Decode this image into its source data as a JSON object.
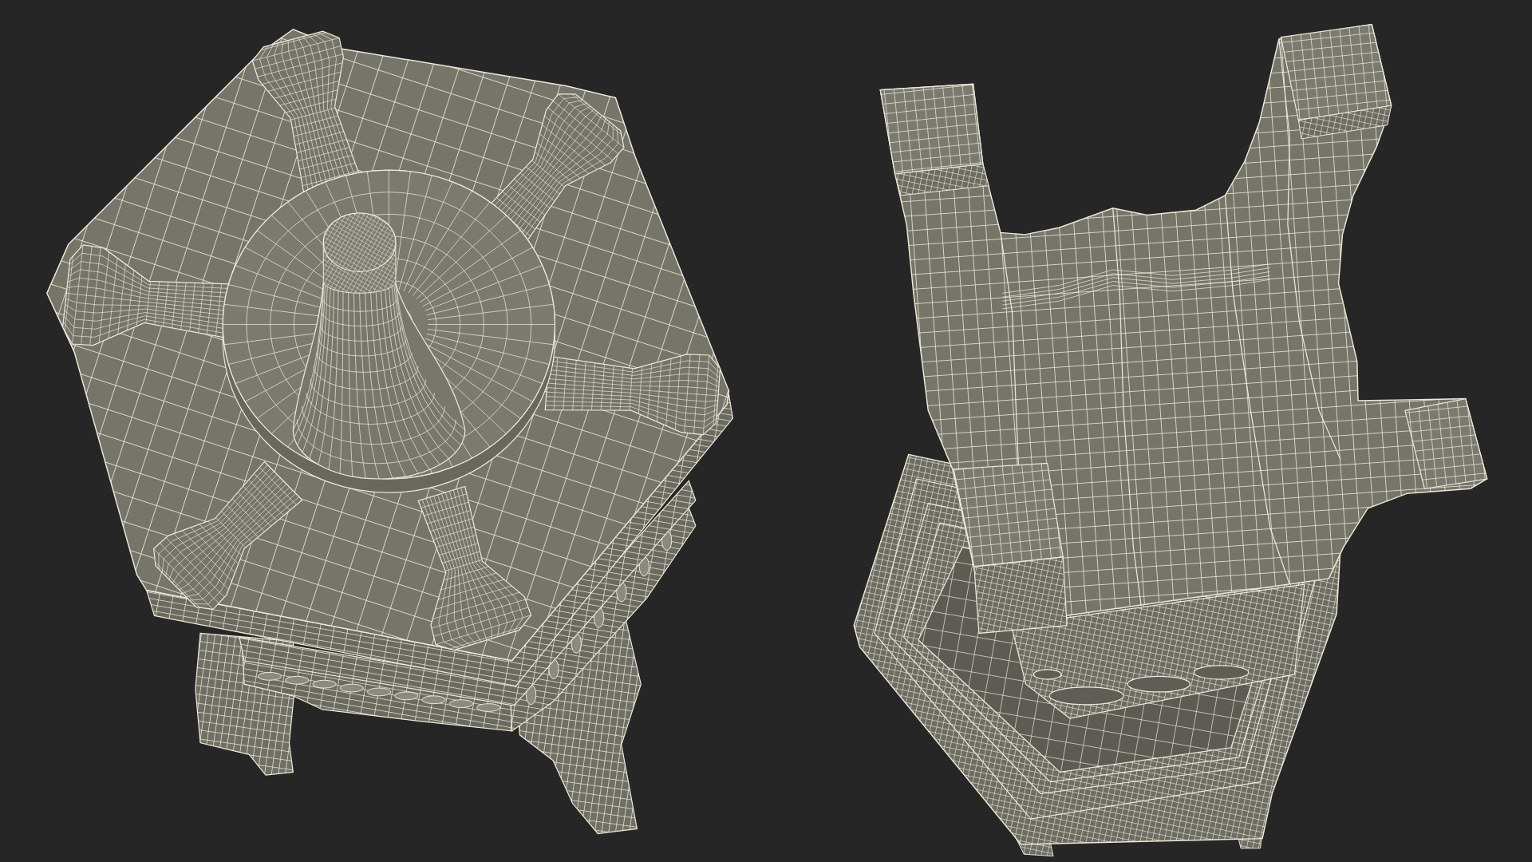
{
  "views": [
    {
      "kind": "top"
    },
    {
      "kind": "underside"
    }
  ]
}
